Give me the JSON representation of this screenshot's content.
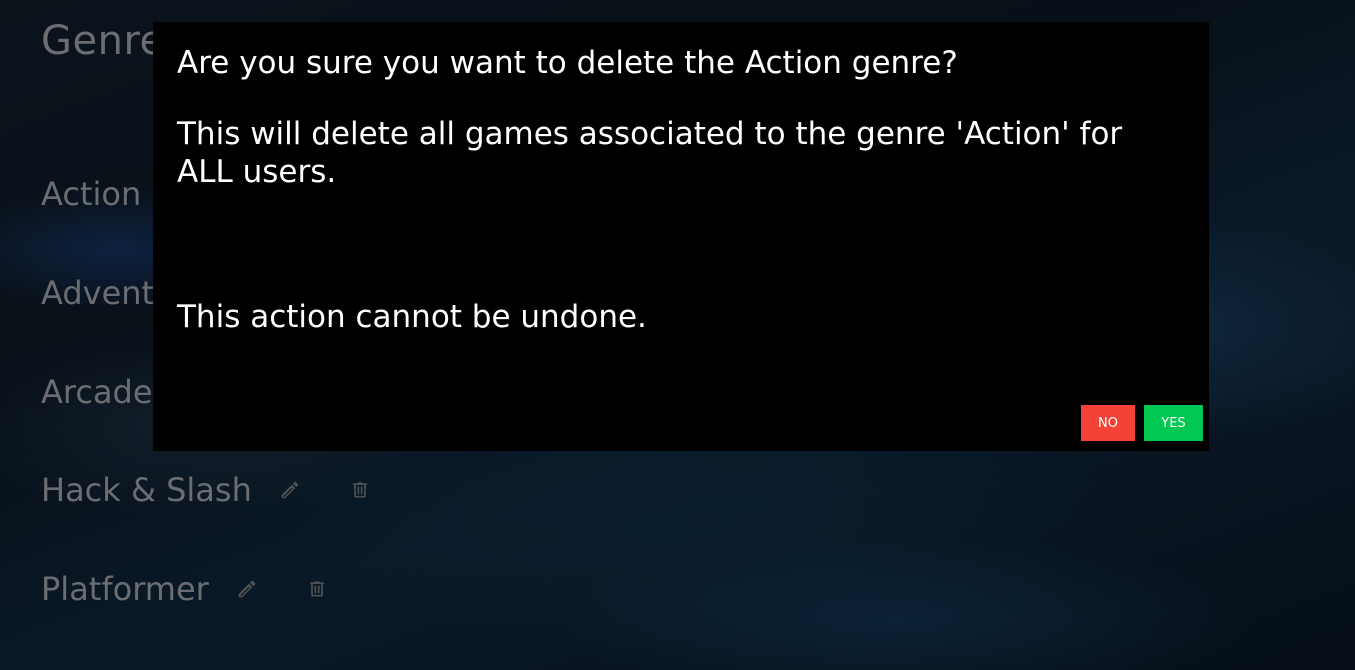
{
  "page": {
    "title": "Genres"
  },
  "genres": [
    {
      "name": "Action"
    },
    {
      "name": "Adventure"
    },
    {
      "name": "Arcade"
    },
    {
      "name": "Hack & Slash"
    },
    {
      "name": "Platformer"
    }
  ],
  "icons": {
    "edit": "pencil-icon",
    "delete": "trash-icon"
  },
  "dialog": {
    "title": "Are you sure you want to delete the Action genre?",
    "body": "This will delete all games associated to the genre 'Action' for ALL users.",
    "warning": "This action cannot be undone.",
    "no_label": "NO",
    "yes_label": "YES"
  },
  "colors": {
    "dialog_background": "#000000",
    "no_button": "#f44336",
    "yes_button": "#00c853",
    "muted_text": "#8f9297"
  }
}
